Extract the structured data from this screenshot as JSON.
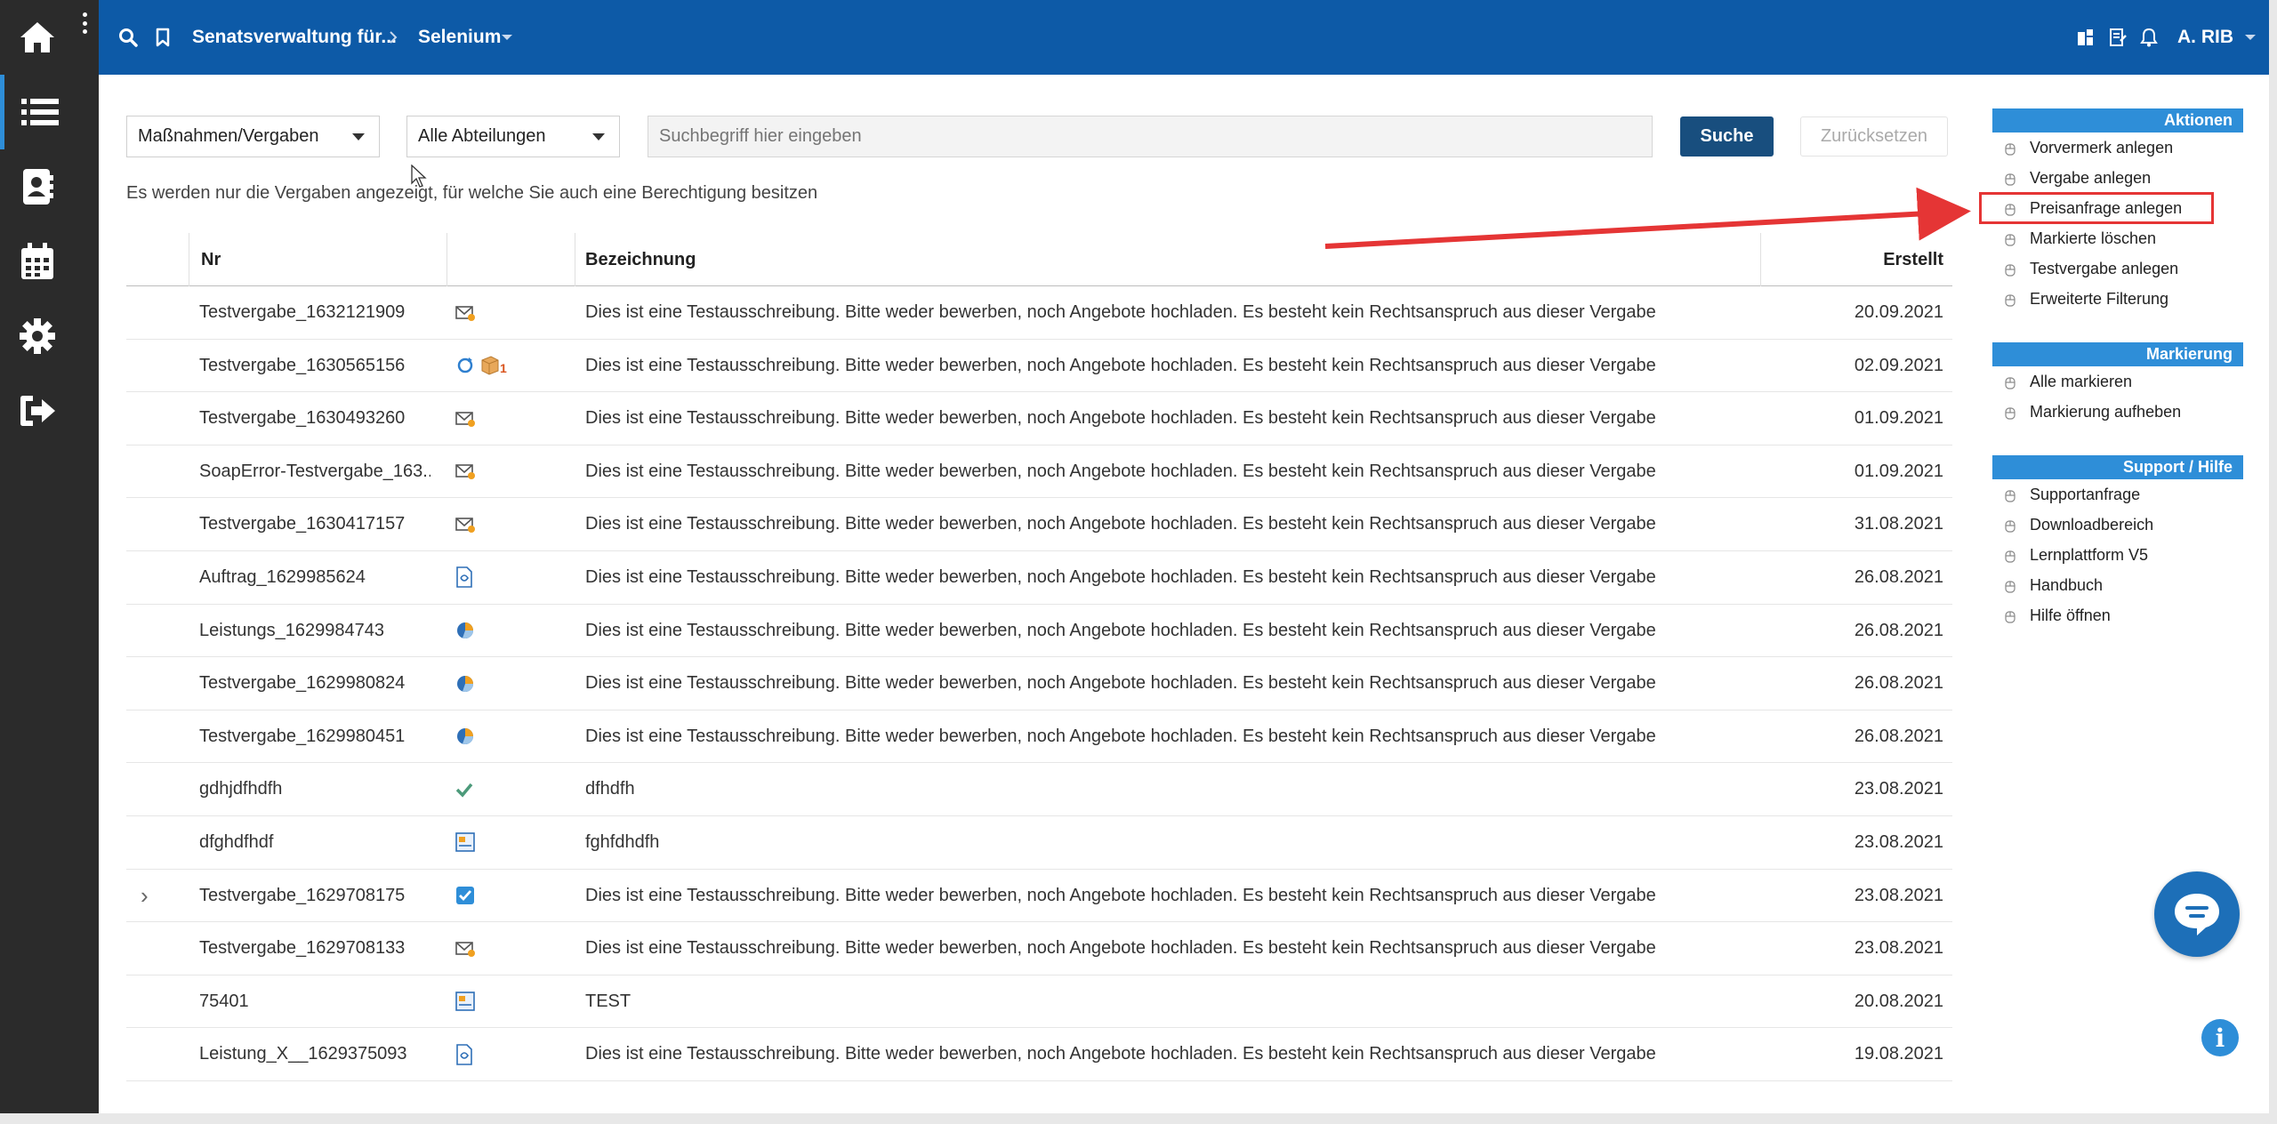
{
  "topbar": {
    "breadcrumb_root": "Senatsverwaltung für...",
    "breadcrumb_current": "Selenium",
    "user": "A. RIB"
  },
  "filters": {
    "category": "Maßnahmen/Vergaben",
    "department": "Alle Abteilungen",
    "search_placeholder": "Suchbegriff hier eingeben",
    "search_button": "Suche",
    "reset_button": "Zurücksetzen",
    "info": "Es werden nur die Vergaben angezeigt, für welche Sie auch eine Berechtigung besitzen"
  },
  "table": {
    "headers": {
      "nr": "Nr",
      "bezeichnung": "Bezeichnung",
      "erstellt": "Erstellt"
    },
    "rows": [
      {
        "nr": "Testvergabe_1632121909",
        "icon": "envelope-icon",
        "bezeichnung": "Dies ist eine Testausschreibung. Bitte weder bewerben, noch Angebote hochladen. Es besteht kein Rechtsanspruch aus dieser Vergabe",
        "erstellt": "20.09.2021"
      },
      {
        "nr": "Testvergabe_1630565156",
        "icon": "refresh-box-icon",
        "badge": "1",
        "bezeichnung": "Dies ist eine Testausschreibung. Bitte weder bewerben, noch Angebote hochladen. Es besteht kein Rechtsanspruch aus dieser Vergabe",
        "erstellt": "02.09.2021"
      },
      {
        "nr": "Testvergabe_1630493260",
        "icon": "envelope-icon",
        "bezeichnung": "Dies ist eine Testausschreibung. Bitte weder bewerben, noch Angebote hochladen. Es besteht kein Rechtsanspruch aus dieser Vergabe",
        "erstellt": "01.09.2021"
      },
      {
        "nr": "SoapError-Testvergabe_163...",
        "icon": "envelope-icon",
        "bezeichnung": "Dies ist eine Testausschreibung. Bitte weder bewerben, noch Angebote hochladen. Es besteht kein Rechtsanspruch aus dieser Vergabe",
        "erstellt": "01.09.2021"
      },
      {
        "nr": "Testvergabe_1630417157",
        "icon": "envelope-icon",
        "bezeichnung": "Dies ist eine Testausschreibung. Bitte weder bewerben, noch Angebote hochladen. Es besteht kein Rechtsanspruch aus dieser Vergabe",
        "erstellt": "31.08.2021"
      },
      {
        "nr": "Auftrag_1629985624",
        "icon": "document-icon",
        "bezeichnung": "Dies ist eine Testausschreibung. Bitte weder bewerben, noch Angebote hochladen. Es besteht kein Rechtsanspruch aus dieser Vergabe",
        "erstellt": "26.08.2021"
      },
      {
        "nr": "Leistungs_1629984743",
        "icon": "pie-chart-icon",
        "bezeichnung": "Dies ist eine Testausschreibung. Bitte weder bewerben, noch Angebote hochladen. Es besteht kein Rechtsanspruch aus dieser Vergabe",
        "erstellt": "26.08.2021"
      },
      {
        "nr": "Testvergabe_1629980824",
        "icon": "pie-chart-icon",
        "bezeichnung": "Dies ist eine Testausschreibung. Bitte weder bewerben, noch Angebote hochladen. Es besteht kein Rechtsanspruch aus dieser Vergabe",
        "erstellt": "26.08.2021"
      },
      {
        "nr": "Testvergabe_1629980451",
        "icon": "pie-chart-icon",
        "bezeichnung": "Dies ist eine Testausschreibung. Bitte weder bewerben, noch Angebote hochladen. Es besteht kein Rechtsanspruch aus dieser Vergabe",
        "erstellt": "26.08.2021"
      },
      {
        "nr": "gdhjdfhdfh",
        "icon": "checkmark-icon",
        "bezeichnung": "dfhdfh",
        "erstellt": "23.08.2021"
      },
      {
        "nr": "dfghdfhdf",
        "icon": "form-icon",
        "bezeichnung": "fghfdhdfh",
        "erstellt": "23.08.2021"
      },
      {
        "nr": "Testvergabe_1629708175",
        "icon": "checkbox-icon",
        "expandable": true,
        "bezeichnung": "Dies ist eine Testausschreibung. Bitte weder bewerben, noch Angebote hochladen. Es besteht kein Rechtsanspruch aus dieser Vergabe",
        "erstellt": "23.08.2021"
      },
      {
        "nr": "Testvergabe_1629708133",
        "icon": "envelope-icon",
        "bezeichnung": "Dies ist eine Testausschreibung. Bitte weder bewerben, noch Angebote hochladen. Es besteht kein Rechtsanspruch aus dieser Vergabe",
        "erstellt": "23.08.2021"
      },
      {
        "nr": "75401",
        "icon": "form-icon",
        "bezeichnung": "TEST",
        "erstellt": "20.08.2021"
      },
      {
        "nr": "Leistung_X__1629375093",
        "icon": "document-icon",
        "bezeichnung": "Dies ist eine Testausschreibung. Bitte weder bewerben, noch Angebote hochladen. Es besteht kein Rechtsanspruch aus dieser Vergabe",
        "erstellt": "19.08.2021"
      }
    ]
  },
  "sidebar": {
    "sections": [
      {
        "title": "Aktionen",
        "items": [
          "Vorvermerk anlegen",
          "Vergabe anlegen",
          "Preisanfrage anlegen",
          "Markierte löschen",
          "Testvergabe anlegen",
          "Erweiterte Filterung"
        ],
        "highlighted_index": 2
      },
      {
        "title": "Markierung",
        "items": [
          "Alle markieren",
          "Markierung aufheben"
        ]
      },
      {
        "title": "Support / Hilfe",
        "items": [
          "Supportanfrage",
          "Downloadbereich",
          "Lernplattform V5",
          "Handbuch",
          "Hilfe öffnen"
        ]
      }
    ]
  },
  "colors": {
    "topbar": "#0d5aa7",
    "rail": "#2b2b2b",
    "sidebar_header": "#2e8ed8",
    "primary_button": "#184e7e",
    "highlight": "#e53535"
  }
}
